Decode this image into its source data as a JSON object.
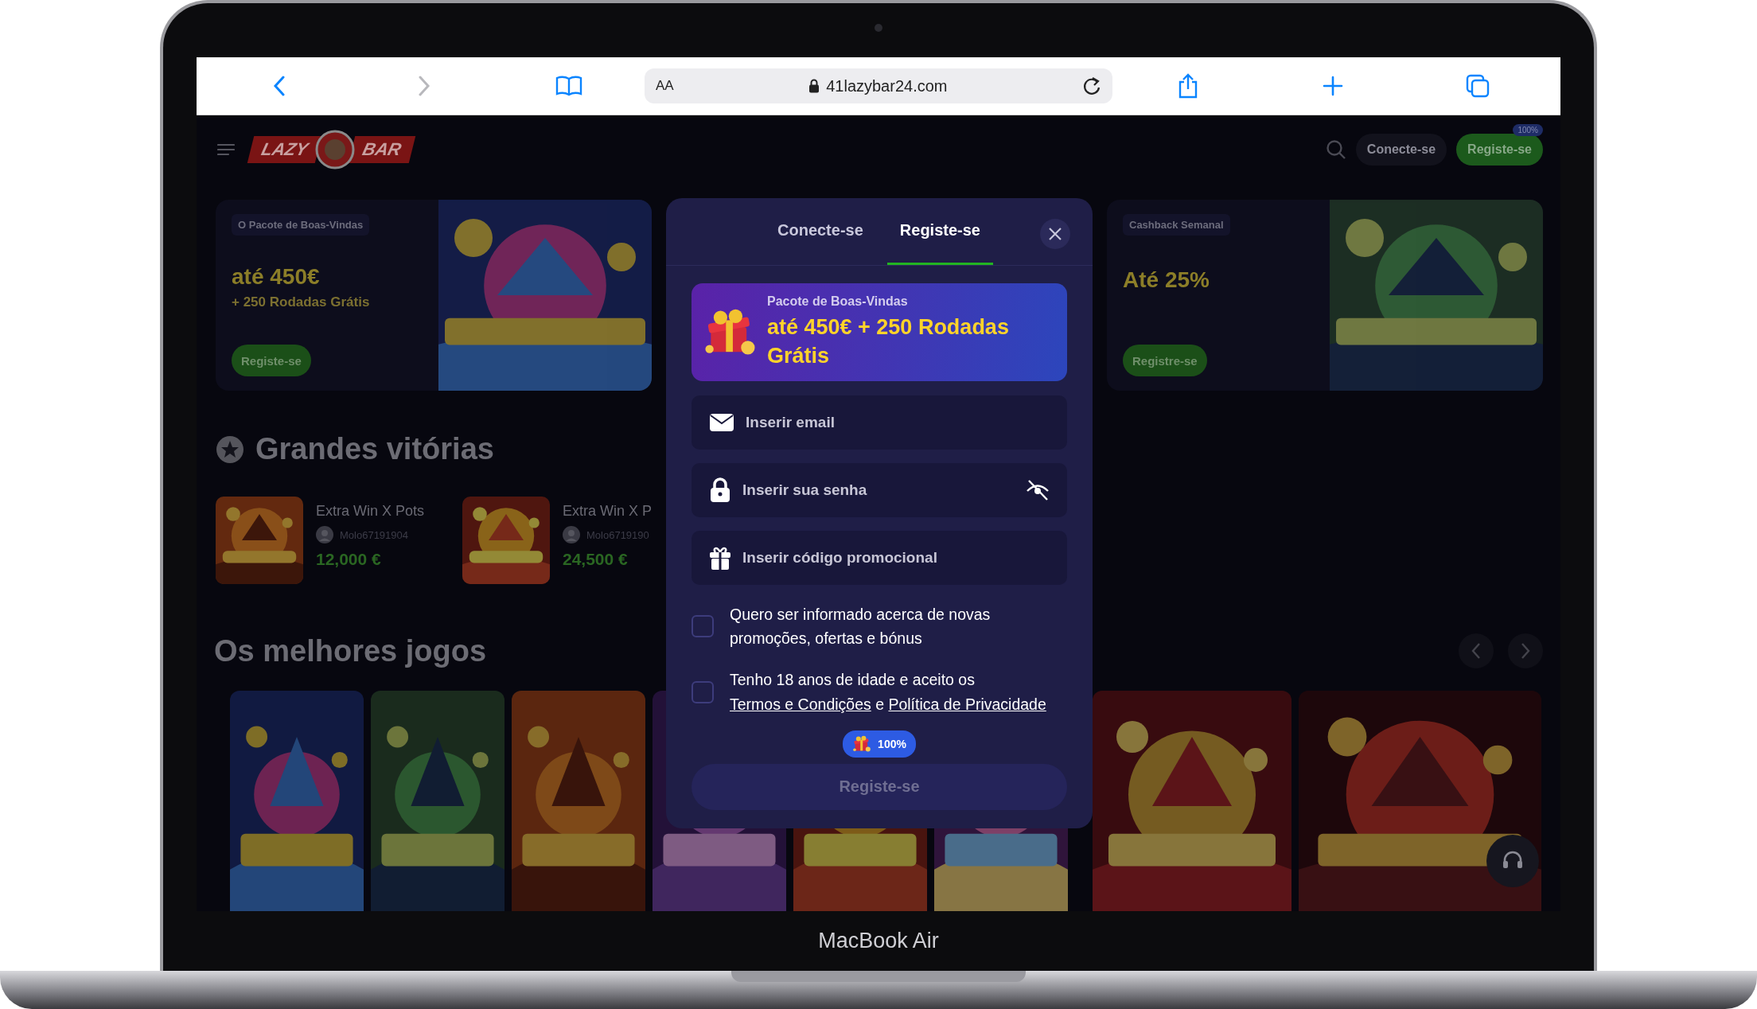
{
  "browser": {
    "text_size": "AA",
    "url": "41lazybar24.com"
  },
  "site": {
    "logo": {
      "left": "LAZY",
      "right": "BAR"
    },
    "header_buttons": [
      {
        "label": "Conecte-se",
        "kind": "outline"
      },
      {
        "label": "Registe-se",
        "kind": "primary",
        "badge": "100%"
      }
    ],
    "banners": [
      {
        "tag": "O Pacote de Boas-Vindas",
        "headline": "até 450€",
        "subline": "+ 250 Rodadas Grátis",
        "button": "Registe-se",
        "kind": "welcome"
      },
      {
        "tag": "Cashback Semanal",
        "headline": "Até 25%",
        "button": "Registre-se",
        "kind": "cashback"
      }
    ],
    "big_wins": {
      "title": "Grandes vitórias",
      "items": [
        {
          "game": "Extra Win X Pots",
          "player": "Molo67191904",
          "amount": "12,000 €"
        },
        {
          "game": "Extra Win X P",
          "player": "Molo6719190",
          "amount": "24,500 €"
        }
      ]
    },
    "best_games": {
      "title": "Os melhores jogos"
    }
  },
  "modal": {
    "tabs": [
      {
        "label": "Conecte-se",
        "selected": false
      },
      {
        "label": "Registe-se",
        "selected": true
      }
    ],
    "promo": {
      "title": "Pacote de Boas-Vindas",
      "offer": "até 450€ + 250 Rodadas Grátis"
    },
    "fields": [
      {
        "kind": "email",
        "placeholder": "Inserir email"
      },
      {
        "kind": "password",
        "placeholder": "Inserir sua senha"
      },
      {
        "kind": "promo",
        "placeholder": "Inserir código promocional"
      }
    ],
    "checkboxes": [
      {
        "checked": false,
        "parts": [
          {
            "text": "Quero ser informado acerca de novas promoções, ofertas e bónus",
            "kind": "text"
          }
        ]
      },
      {
        "checked": false,
        "parts": [
          {
            "text": "Tenho 18 anos de idade e aceito os ",
            "kind": "text"
          },
          {
            "text": "Termos e Condições",
            "kind": "link"
          },
          {
            "text": " e ",
            "kind": "text"
          },
          {
            "text": "Política de Privacidade",
            "kind": "link"
          }
        ]
      }
    ],
    "bonus_badge": "100%",
    "submit": {
      "label": "Registe-se",
      "disabled": true
    }
  },
  "device": {
    "label": "MacBook Air"
  }
}
